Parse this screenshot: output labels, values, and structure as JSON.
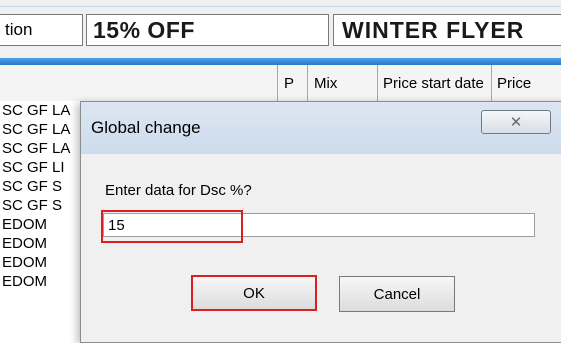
{
  "header": {
    "action_fragment": "tion",
    "discount_label": "15% OFF",
    "promo_name": "WINTER FLYER"
  },
  "grid": {
    "columns": [
      "P",
      "Mix",
      "Price start date",
      "Price"
    ],
    "rows": [
      "SC GF LA",
      "SC GF LA",
      "SC GF LA",
      "SC GF LI",
      "SC GF S",
      "SC GF S",
      "EDOM",
      "EDOM",
      "EDOM",
      "EDOM"
    ]
  },
  "dialog": {
    "title": "Global change",
    "close_glyph": "✕",
    "prompt": "Enter data for Dsc %?",
    "input_value": "15",
    "ok_label": "OK",
    "cancel_label": "Cancel"
  },
  "colors": {
    "highlight": "#d92020",
    "accent_bar": "#2b79c9"
  }
}
